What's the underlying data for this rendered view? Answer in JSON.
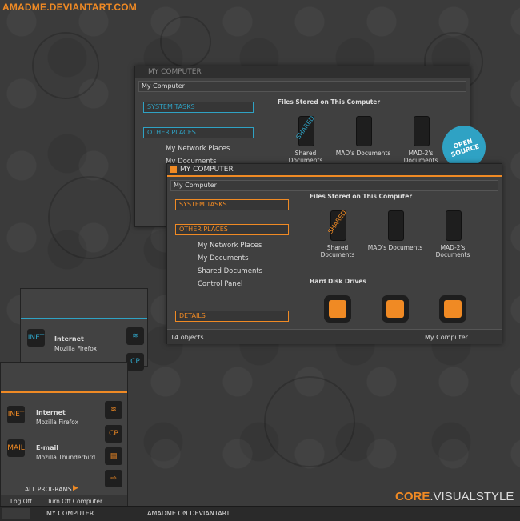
{
  "brand": "AMADME.DEVIANTART.COM",
  "back_window": {
    "title": "MY COMPUTER",
    "address": "My Computer",
    "system_tasks": "SYSTEM TASKS",
    "other_places": "OTHER PLACES",
    "places": [
      "My Network Places",
      "My Documents"
    ],
    "files_heading": "Files Stored on This Computer",
    "icons": [
      "Shared Documents",
      "MAD's Documents",
      "MAD-2's Documents"
    ],
    "shared_tag": "SHARED"
  },
  "badge": "OPEN SOURCE",
  "front_window": {
    "title": "MY COMPUTER",
    "address": "My Computer",
    "system_tasks": "SYSTEM TASKS",
    "other_places": "OTHER PLACES",
    "places": [
      "My Network Places",
      "My Documents",
      "Shared Documents",
      "Control Panel"
    ],
    "details": "DETAILS",
    "files_heading": "Files Stored on This Computer",
    "icons": [
      "Shared Documents",
      "MAD's Documents",
      "MAD-2's Documents"
    ],
    "shared_tag": "SHARED",
    "hdd_heading": "Hard Disk Drives",
    "status_left": "14 objects",
    "status_right": "My Computer"
  },
  "back_menu": {
    "inet_tag": "INET",
    "internet": "Internet",
    "internet_sub": "Mozilla Firefox",
    "cp": "CP"
  },
  "front_menu": {
    "inet_tag": "INET",
    "internet": "Internet",
    "internet_sub": "Mozilla Firefox",
    "mail_tag": "MAIL",
    "email": "E-mail",
    "email_sub": "Mozilla Thunderbird",
    "cp": "CP",
    "all_programs": "ALL PROGRAMS",
    "log_off": "Log Off",
    "turn_off": "Turn Off Computer"
  },
  "taskbar": {
    "item1": "MY COMPUTER",
    "item2": "AMADME ON DEVIANTART ..."
  },
  "core_label": {
    "a": "CORE",
    "b": ".VISUALSTYLE"
  },
  "colors": {
    "accent": "#f08a24",
    "teal": "#2fa2c4"
  }
}
